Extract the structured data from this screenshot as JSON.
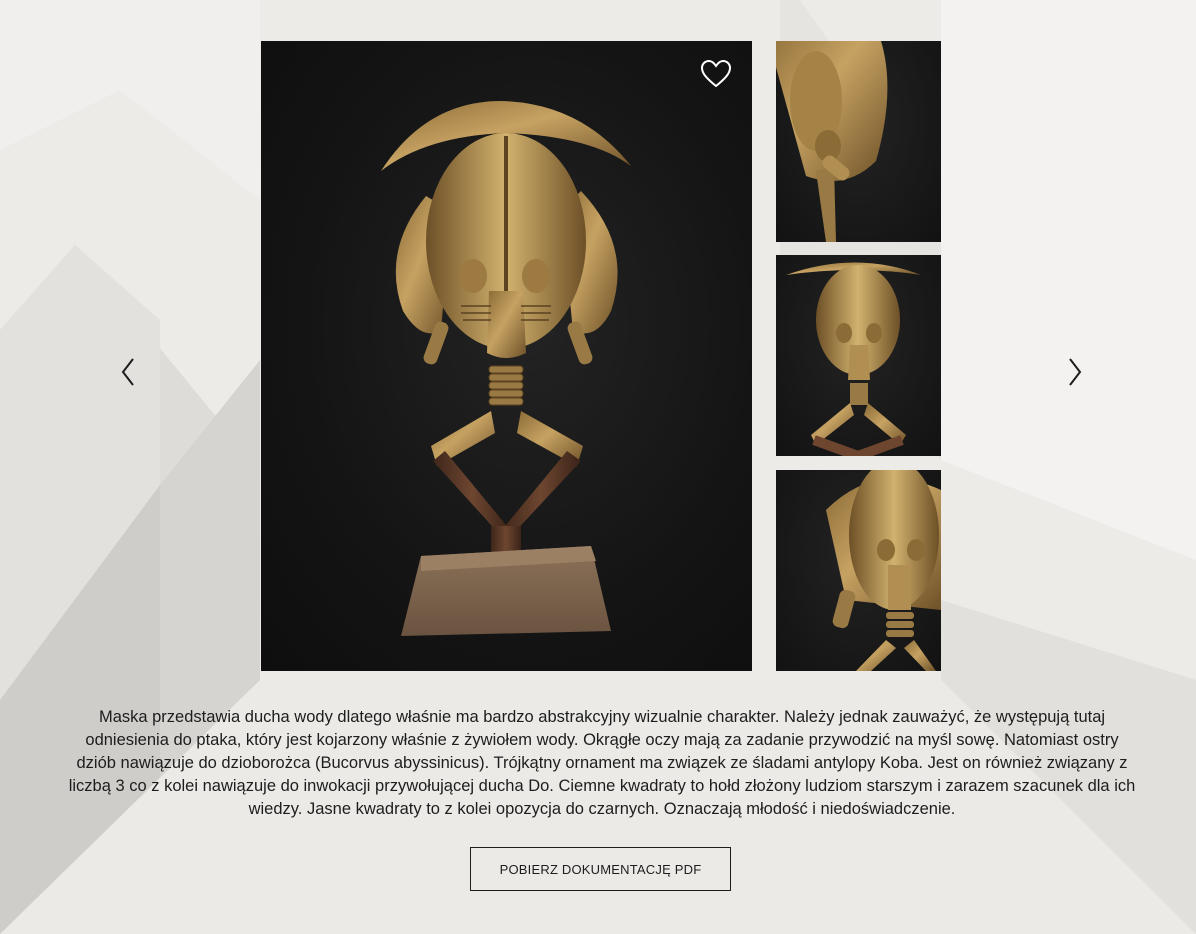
{
  "gallery": {
    "main_image": {
      "alt": "kota-reliquary-figure-front",
      "icon": "kota-figure-icon"
    },
    "favorite_icon": "heart-icon",
    "prev_icon": "chevron-left-icon",
    "next_icon": "chevron-right-icon",
    "thumbnails": [
      {
        "icon": "kota-figure-closeup-icon"
      },
      {
        "icon": "kota-figure-three-quarter-icon"
      },
      {
        "icon": "kota-figure-side-icon"
      }
    ]
  },
  "description": "Maska przedstawia ducha wody dlatego właśnie ma bardzo abstrakcyjny wizualnie charakter. Należy jednak zauważyć, że występują tutaj odniesienia do ptaka, który jest kojarzony właśnie z żywiołem wody. Okrągłe oczy mają za zadanie przywodzić na myśl sowę. Natomiast ostry dziób nawiązuje do dzioborożca (Bucorvus abyssinicus). Trójkątny ornament ma związek ze śladami antylopy Koba. Jest on również związany z liczbą 3 co z kolei nawiązuje do inwokacji przywołującej ducha Do. Ciemne kwadraty to hołd złożony ludziom starszym i zarazem szacunek dla ich wiedzy. Jasne kwadraty to z kolei opozycja do czarnych. Oznaczają młodość i niedoświadczenie.",
  "pdf_button_label": "POBIERZ DOKUMENTACJĘ PDF",
  "colors": {
    "background": "#ecebe8",
    "photo_background": "#141414",
    "brass": "#b08a4a",
    "wood": "#5a3a28",
    "text": "#1d1d1d"
  }
}
